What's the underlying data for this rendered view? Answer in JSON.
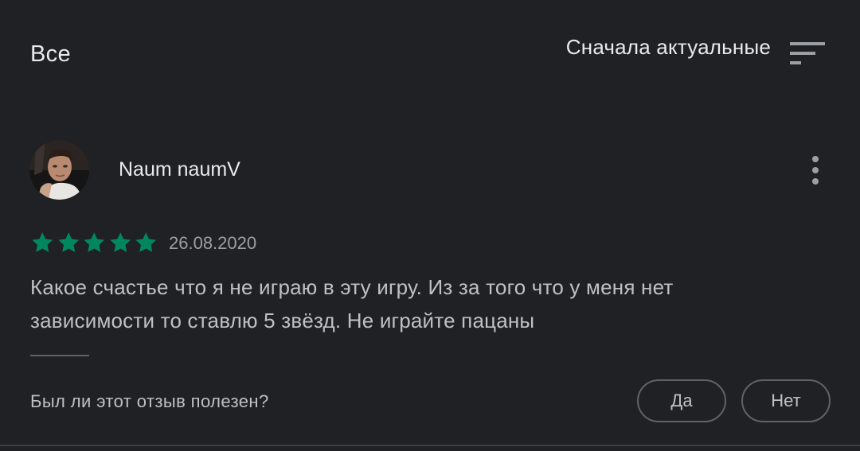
{
  "header": {
    "filter_label": "Все",
    "sort_label": "Сначала актуальные",
    "sort_icon": "sort-icon"
  },
  "review": {
    "author": "Naum naumV",
    "avatar_icon": "user-avatar",
    "more_icon": "more-vert-icon",
    "rating": 5,
    "rating_max": 5,
    "date": "26.08.2020",
    "text": "Какое счастье что я не играю в эту игру. Из за того что у меня нет зависимости то ставлю 5 звёзд. Не играйте пацаны"
  },
  "feedback": {
    "question": "Был ли этот отзыв полезен?",
    "yes_label": "Да",
    "no_label": "Нет"
  },
  "colors": {
    "background": "#202124",
    "star": "#01875f",
    "text_primary": "#e8eaed",
    "text_secondary": "#bdc1c6"
  }
}
